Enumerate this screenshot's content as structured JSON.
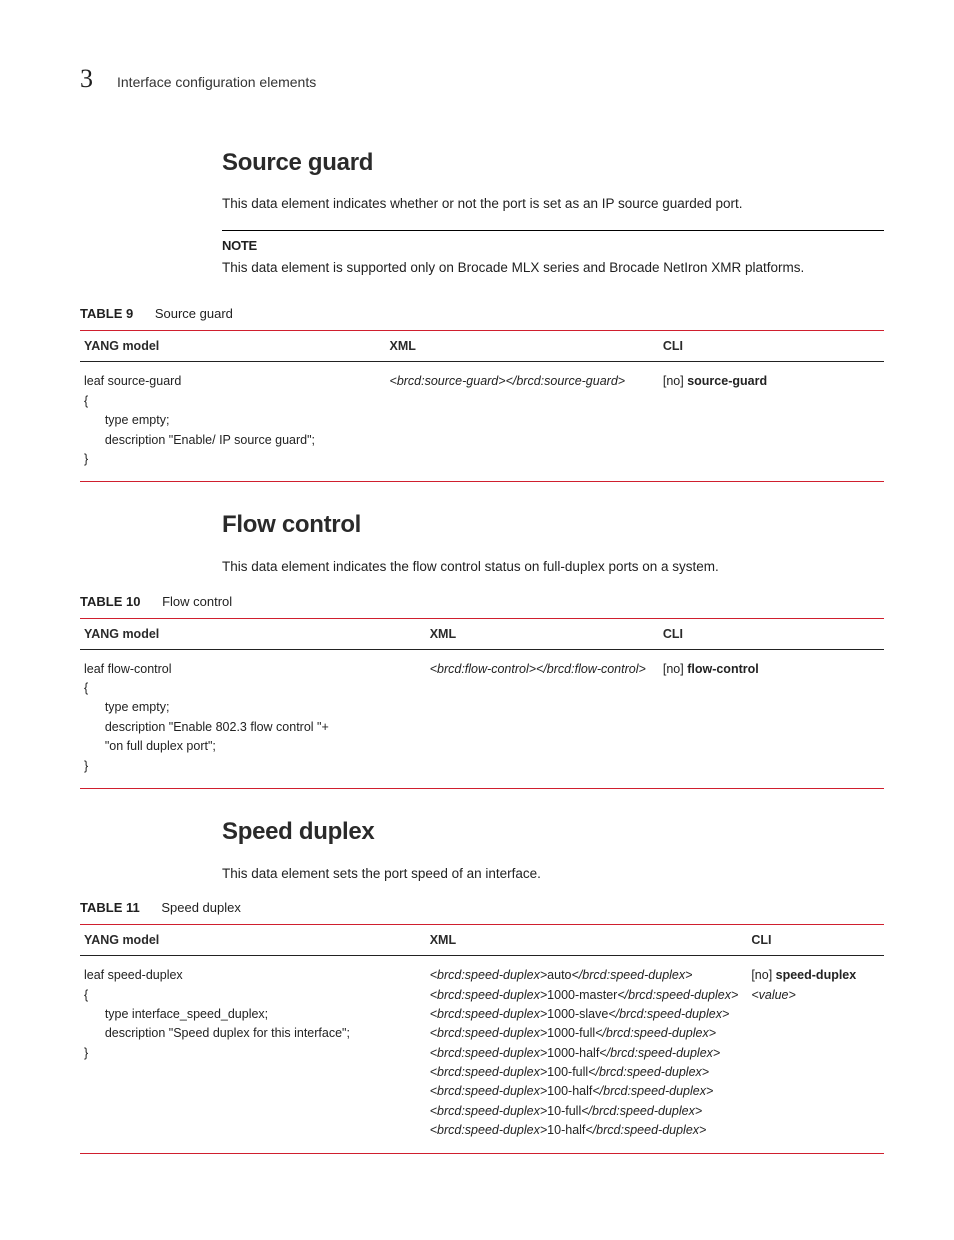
{
  "header": {
    "chapter_number": "3",
    "chapter_title": "Interface configuration elements"
  },
  "sections": [
    {
      "heading": "Source guard",
      "intro": "This data element indicates whether or not the port is set as an IP source guarded port.",
      "note_label": "NOTE",
      "note_text": "This data element is supported only on Brocade MLX series and Brocade NetIron XMR platforms.",
      "table": {
        "label": "TABLE 9",
        "title": "Source guard",
        "columns": [
          "YANG model",
          "XML",
          "CLI"
        ],
        "yang": "leaf source-guard\n{\n      type empty;\n      description \"Enable/ IP source guard\";\n}",
        "xml_lines": [
          {
            "tag_open": "<brcd:source-guard>",
            "value": "",
            "tag_close": "</brcd:source-guard>"
          }
        ],
        "cli_prefix_bracket": "[no] ",
        "cli_cmd": "source-guard",
        "cli_arg": ""
      }
    },
    {
      "heading": "Flow control",
      "intro": "This data element indicates the flow control status on full-duplex ports on a system.",
      "table": {
        "label": "TABLE 10",
        "title": "Flow control",
        "columns": [
          "YANG model",
          "XML",
          "CLI"
        ],
        "yang": "leaf flow-control\n{\n      type empty;\n      description \"Enable 802.3 flow control \"+\n      \"on full duplex port\";\n}",
        "xml_lines": [
          {
            "tag_open": "<brcd:flow-control>",
            "value": "",
            "tag_close": "</brcd:flow-control>"
          }
        ],
        "cli_prefix_bracket": "[no] ",
        "cli_cmd": "flow-control",
        "cli_arg": ""
      }
    },
    {
      "heading": "Speed duplex",
      "intro": "This data element sets the port speed of an interface.",
      "table": {
        "label": "TABLE 11",
        "title": "Speed duplex",
        "columns": [
          "YANG model",
          "XML",
          "CLI"
        ],
        "yang": "leaf speed-duplex\n{\n      type interface_speed_duplex;\n      description \"Speed duplex for this interface\";\n}",
        "xml_lines": [
          {
            "tag_open": "<brcd:speed-duplex>",
            "value": "auto",
            "tag_close": "</brcd:speed-duplex>"
          },
          {
            "tag_open": "<brcd:speed-duplex>",
            "value": "1000-master",
            "tag_close": "</brcd:speed-duplex>"
          },
          {
            "tag_open": "<brcd:speed-duplex>",
            "value": "1000-slave",
            "tag_close": "</brcd:speed-duplex>"
          },
          {
            "tag_open": "<brcd:speed-duplex>",
            "value": "1000-full",
            "tag_close": "</brcd:speed-duplex>"
          },
          {
            "tag_open": "<brcd:speed-duplex>",
            "value": "1000-half",
            "tag_close": "</brcd:speed-duplex>"
          },
          {
            "tag_open": "<brcd:speed-duplex>",
            "value": "100-full",
            "tag_close": "</brcd:speed-duplex>"
          },
          {
            "tag_open": "<brcd:speed-duplex>",
            "value": "100-half",
            "tag_close": "</brcd:speed-duplex>"
          },
          {
            "tag_open": "<brcd:speed-duplex>",
            "value": "10-full",
            "tag_close": "</brcd:speed-duplex>"
          },
          {
            "tag_open": "<brcd:speed-duplex>",
            "value": "10-half",
            "tag_close": "</brcd:speed-duplex>"
          }
        ],
        "cli_prefix_bracket": "[no] ",
        "cli_cmd": "speed-duplex",
        "cli_arg": "<value>"
      }
    }
  ]
}
